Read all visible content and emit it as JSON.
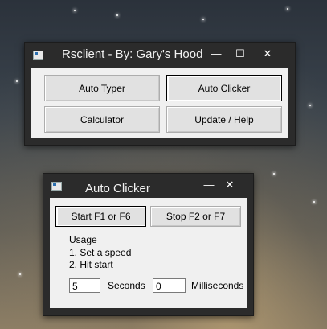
{
  "main_window": {
    "title": "Rsclient - By: Gary's Hood",
    "controls": {
      "minimize": "—",
      "maximize": "☐",
      "close": "✕"
    },
    "buttons": {
      "auto_typer": "Auto Typer",
      "auto_clicker": "Auto Clicker",
      "calculator": "Calculator",
      "update_help": "Update / Help"
    }
  },
  "clicker_window": {
    "title": "Auto Clicker",
    "controls": {
      "minimize": "—",
      "close": "✕"
    },
    "buttons": {
      "start": "Start F1 or F6",
      "stop": "Stop F2 or F7"
    },
    "usage": {
      "heading": "Usage",
      "step1": "1. Set a speed",
      "step2": "2. Hit start"
    },
    "seconds": {
      "value": "5",
      "label": "Seconds"
    },
    "milliseconds": {
      "value": "0",
      "label": "Milliseconds"
    }
  }
}
